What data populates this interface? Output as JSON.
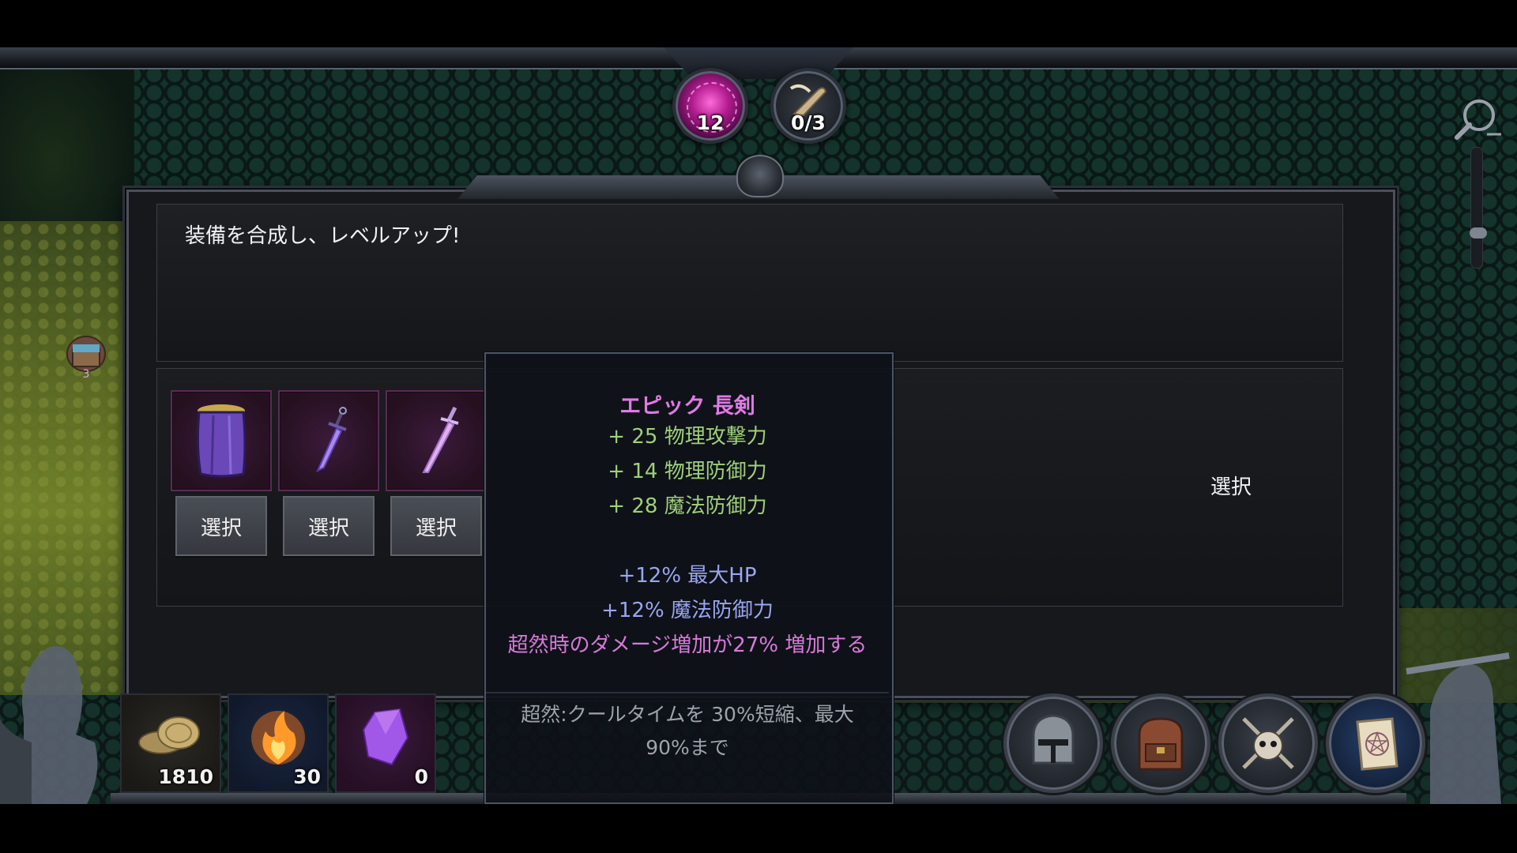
{
  "top_badges": {
    "magic_count": "12",
    "quest_progress": "0/3"
  },
  "map": {
    "chest_count": "3"
  },
  "panel": {
    "description": "装備を合成し、レベルアップ!",
    "right_select_label": "選択",
    "items": [
      {
        "icon": "cape-icon",
        "select_label": "選択"
      },
      {
        "icon": "dagger-icon",
        "select_label": "選択"
      },
      {
        "icon": "sword-icon",
        "select_label": "選択"
      }
    ]
  },
  "tooltip": {
    "title": "エピック 長剣",
    "base_stats": [
      "+ 25 物理攻撃力",
      "+ 14 物理防御力",
      "+ 28 魔法防御力"
    ],
    "bonus_stats": [
      "+12% 最大HP",
      "+12% 魔法防御力"
    ],
    "special": "超然時のダメージ増加が27% 増加する",
    "footer": "超然:クールタイムを 30%短縮、最大 90%まで"
  },
  "resources": {
    "gold": "1810",
    "fire": "30",
    "gem": "0"
  },
  "menu_buttons": [
    "helmet-icon",
    "backpack-icon",
    "skull-crossbones-icon",
    "map-scroll-icon"
  ],
  "colors": {
    "tooltip_title": "#e07ae6",
    "stat_green": "#9fd07a",
    "stat_blue": "#9aa6ef",
    "stat_pink": "#d77ad8"
  }
}
